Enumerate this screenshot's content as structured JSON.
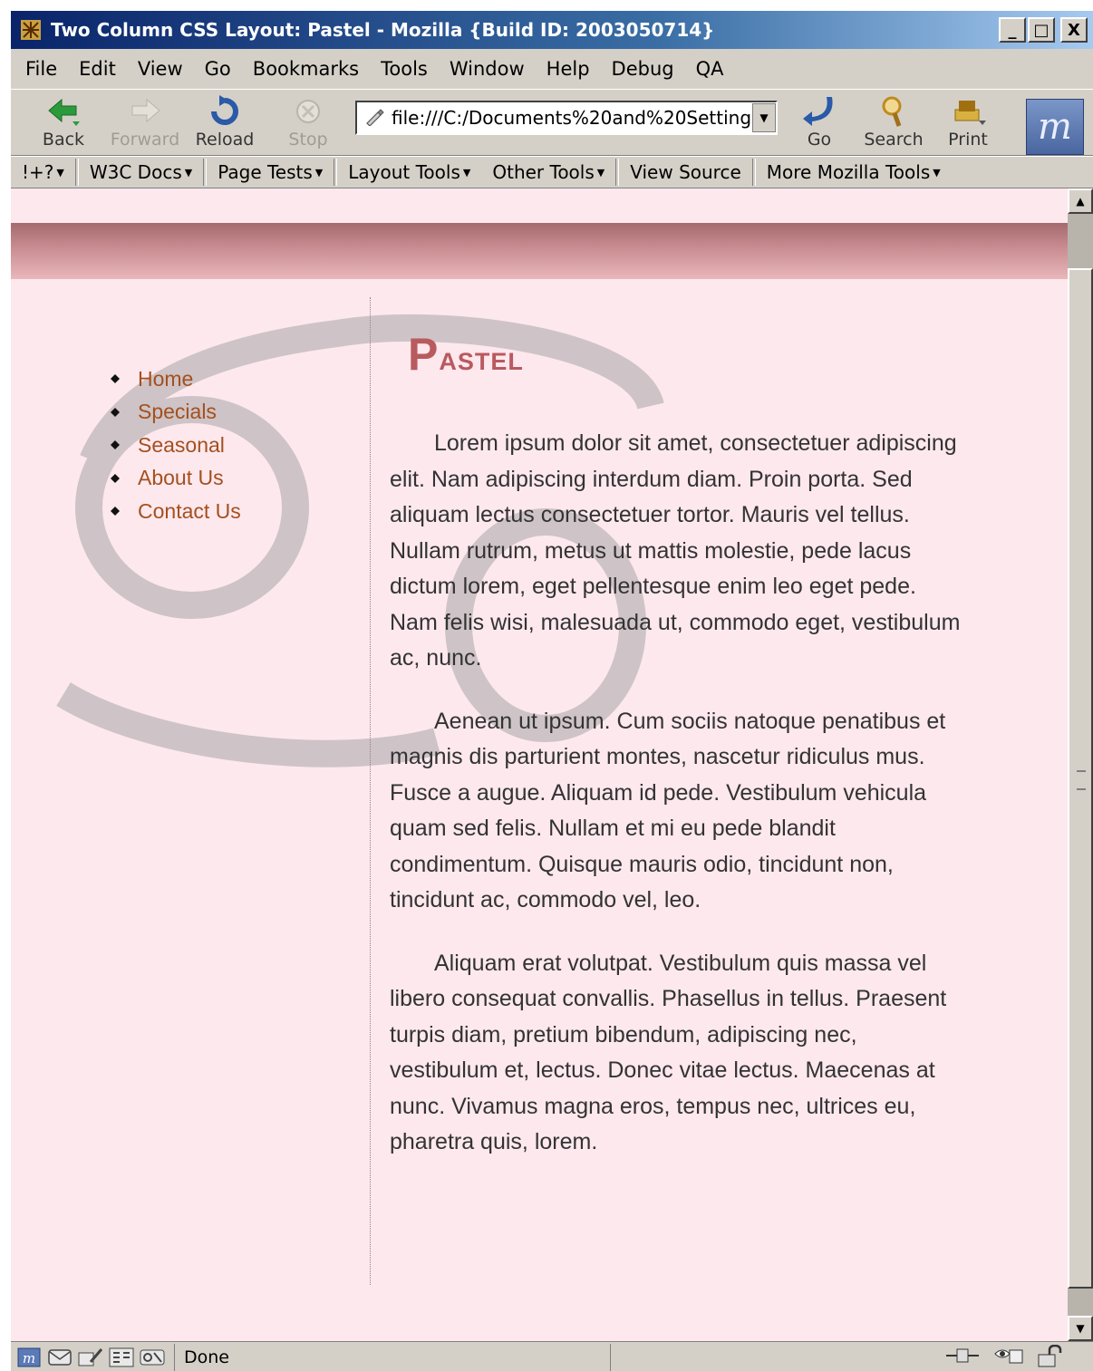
{
  "window": {
    "title": "Two Column CSS Layout: Pastel - Mozilla {Build ID: 2003050714}",
    "controls": {
      "minimize": "_",
      "maximize": "□",
      "close": "X"
    }
  },
  "menubar": {
    "items": [
      "File",
      "Edit",
      "View",
      "Go",
      "Bookmarks",
      "Tools",
      "Window",
      "Help",
      "Debug",
      "QA"
    ]
  },
  "navbar": {
    "back": "Back",
    "forward": "Forward",
    "reload": "Reload",
    "stop": "Stop",
    "url": "file:///C:/Documents%20and%20Setting",
    "go": "Go",
    "search": "Search",
    "print": "Print",
    "throbber": "m"
  },
  "personal_toolbar": {
    "items": [
      "!+?",
      "W3C Docs",
      "Page Tests",
      "Layout Tools",
      "Other Tools",
      "View Source",
      "More Mozilla Tools"
    ]
  },
  "page": {
    "title_first": "P",
    "title_rest": "astel",
    "nav": [
      "Home",
      "Specials",
      "Seasonal",
      "About Us",
      "Contact Us"
    ],
    "paragraphs": [
      "Lorem ipsum dolor sit amet, consectetuer adipiscing elit. Nam adipiscing interdum diam. Proin porta. Sed aliquam lectus consectetuer tortor. Mauris vel tellus. Nullam rutrum, metus ut mattis molestie, pede lacus dictum lorem, eget pellentesque enim leo eget pede. Nam felis wisi, malesuada ut, commodo eget, vestibulum ac, nunc.",
      "Aenean ut ipsum. Cum sociis natoque penatibus et magnis dis parturient montes, nascetur ridiculus mus. Fusce a augue. Aliquam id pede. Vestibulum vehicula quam sed felis. Nullam et mi eu pede blandit condimentum. Quisque mauris odio, tincidunt non, tincidunt ac, commodo vel, leo.",
      "Aliquam erat volutpat. Vestibulum quis massa vel libero consequat convallis. Phasellus in tellus. Praesent turpis diam, pretium bibendum, adipiscing nec, vestibulum et, lectus. Donec vitae lectus. Maecenas at nunc. Vivamus magna eros, tempus nec, ultrices eu, pharetra quis, lorem."
    ]
  },
  "statusbar": {
    "text": "Done"
  },
  "colors": {
    "page_background": "#fde8ee",
    "banner": "#c98d92",
    "link": "#a4501e",
    "heading": "#b85a5e",
    "body_text": "#333333",
    "title_bar": "#0a246a"
  }
}
